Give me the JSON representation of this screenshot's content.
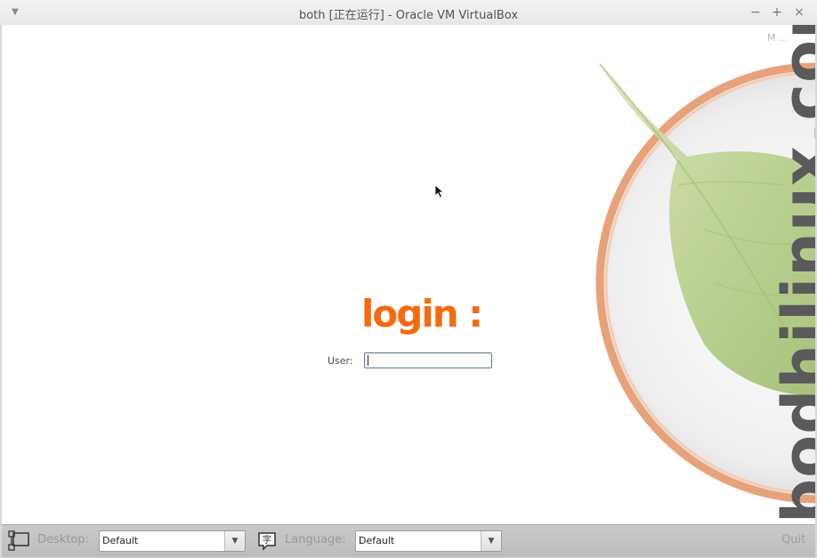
{
  "window": {
    "title": "both [正在运行] - Oracle VM VirtualBox",
    "menu_icon": "chevron-down-icon",
    "minimize_glyph": "−",
    "maximize_glyph": "+",
    "close_glyph": "×"
  },
  "screen": {
    "watermark": "bodhilinux.com",
    "corner_text": "M ...",
    "login_title": "login :",
    "user_label": "User:",
    "user_value": ""
  },
  "bottombar": {
    "desktop_icon": "desktop-session-icon",
    "desktop_label": "Desktop:",
    "desktop_value": "Default",
    "language_icon": "language-icon",
    "language_label": "Language:",
    "language_value": "Default",
    "quit_label": "Quit"
  },
  "colors": {
    "login_accent": "#f56a0e",
    "leaf_green": "#b9d08c",
    "ring_orange": "#e8a27a"
  }
}
